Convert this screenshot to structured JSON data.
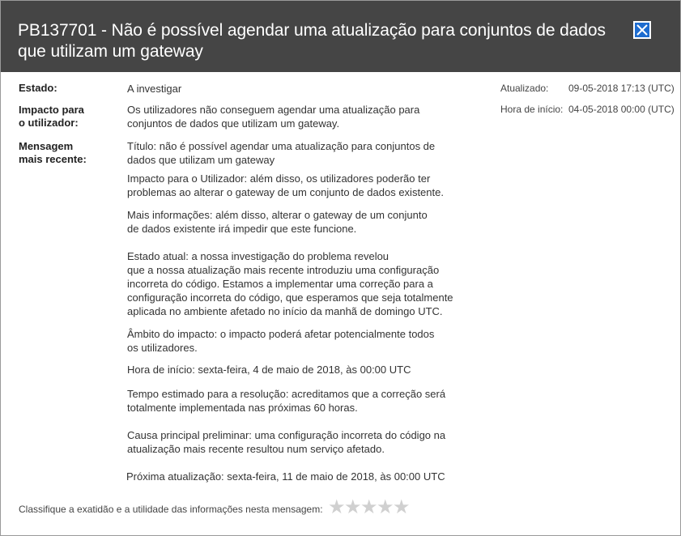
{
  "header": {
    "title": "PB137701 - Não é possível agendar uma atualização para conjuntos de dados que utilizam um gateway",
    "close_icon": "close-icon"
  },
  "details": {
    "state_label": "Estado:",
    "state_value": "A investigar",
    "impact_label": "Impacto para\no utilizador:",
    "impact_value": "Os utilizadores não conseguem agendar uma atualização para\nconjuntos de dados que utilizam um gateway.",
    "message_label": "Mensagem\nmais recente:",
    "message_paragraphs": [
      "Título: não é possível agendar uma atualização para conjuntos de\ndados que utilizam um gateway",
      "Impacto para o Utilizador: além disso, os utilizadores poderão ter\nproblemas ao alterar o gateway de um conjunto de dados existente.",
      "Mais informações: além disso, alterar o gateway de um conjunto\nde dados existente irá impedir que este funcione.",
      "Estado atual: a nossa investigação do problema revelou\nque a nossa atualização mais recente introduziu uma configuração\nincorreta do código.  Estamos a implementar uma correção para a\nconfiguração incorreta do código, que esperamos que seja totalmente\naplicada no ambiente afetado no início da manhã de domingo UTC.",
      "Âmbito do impacto: o impacto poderá afetar potencialmente todos\nos utilizadores.",
      "Hora de início: sexta-feira, 4 de maio de 2018, às 00:00 UTC",
      "Tempo estimado para a resolução: acreditamos que a correção será\ntotalmente implementada nas próximas 60 horas.",
      "Causa principal preliminar: uma configuração incorreta do código na\natualização mais recente resultou num serviço afetado.",
      "Próxima atualização: sexta-feira, 11 de maio de 2018, às 00:00 UTC"
    ]
  },
  "meta": {
    "updated_label": "Atualizado:",
    "updated_value": "09-05-2018 17:13 (UTC)",
    "start_label": "Hora de início:",
    "start_value": "04-05-2018 00:00 (UTC)"
  },
  "rating": {
    "prompt": "Classifique a exatidão e a utilidade das informações nesta mensagem:",
    "max_stars": 5,
    "selected": 0,
    "star_glyph": "★"
  }
}
